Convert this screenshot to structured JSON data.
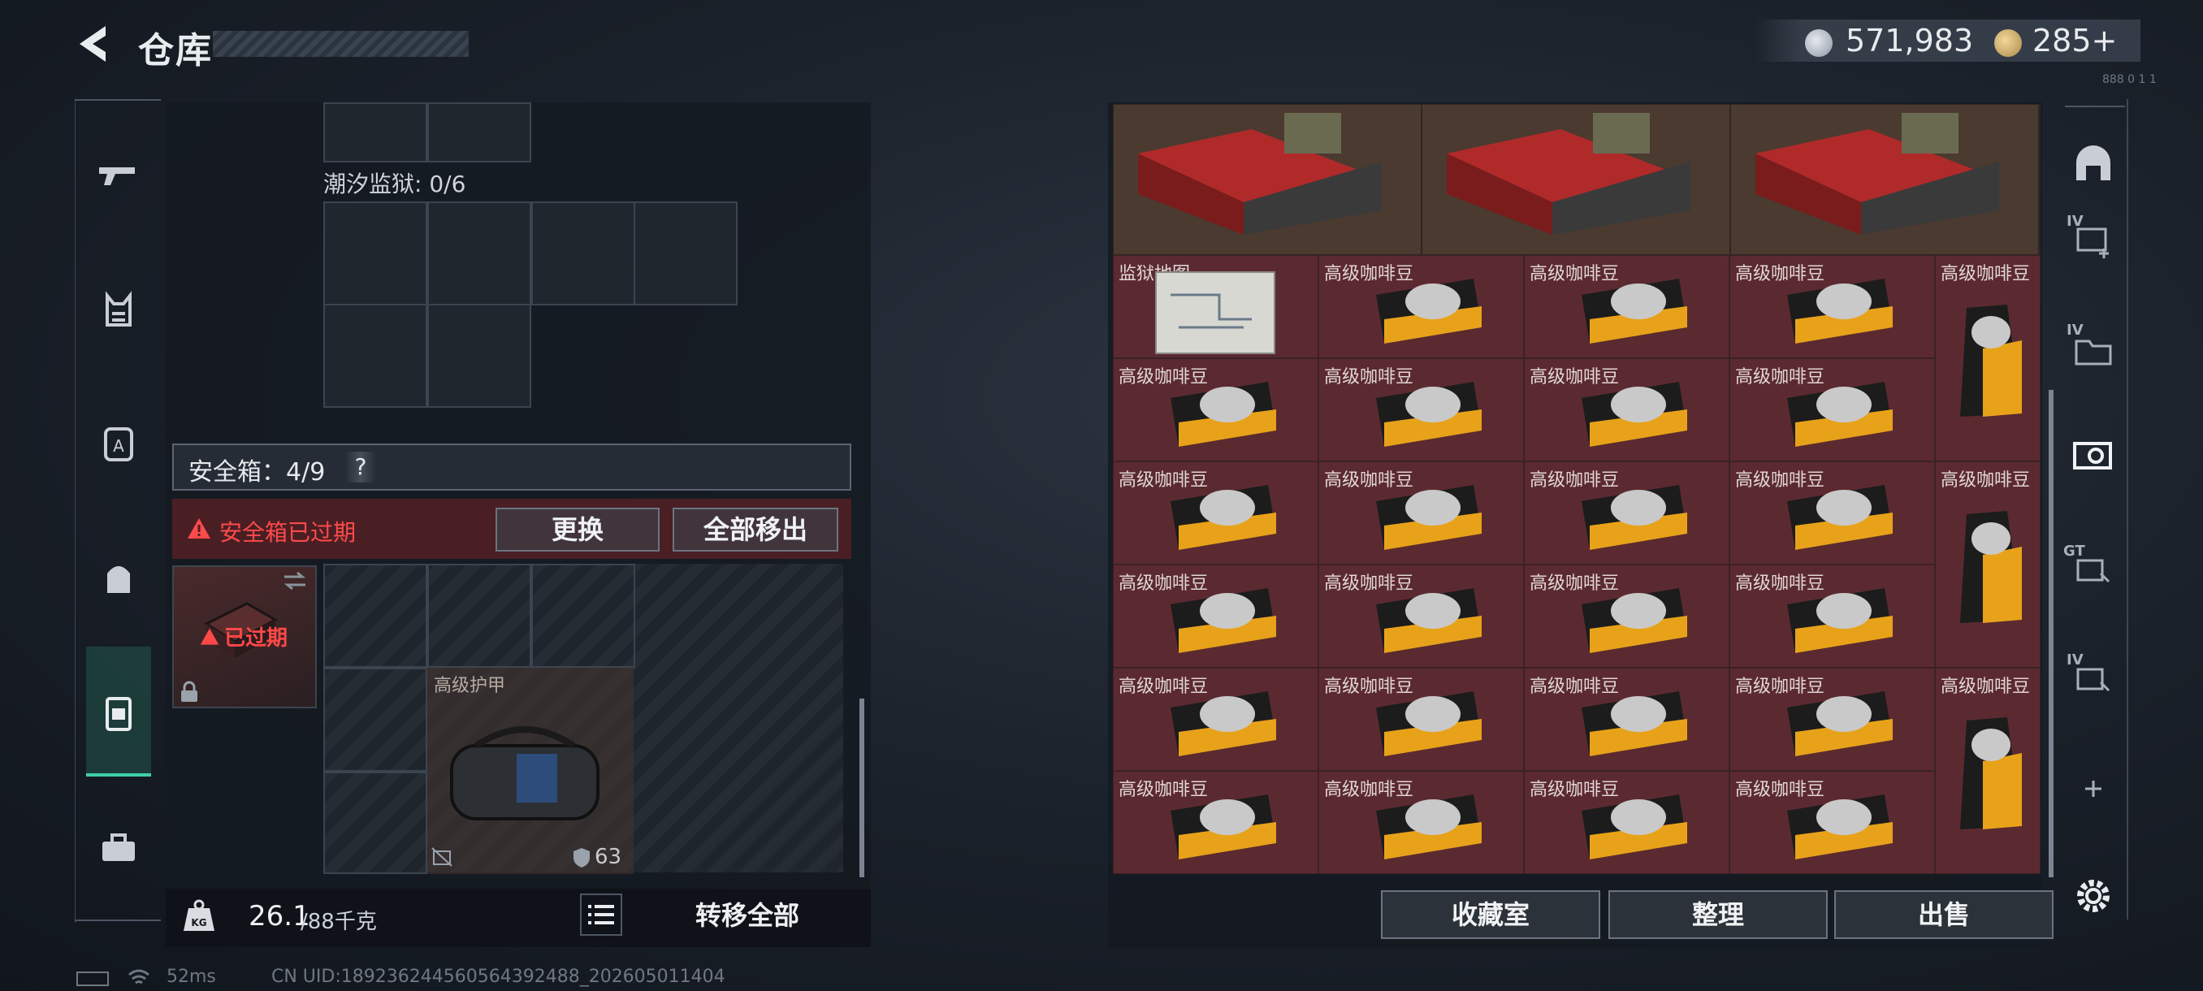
{
  "header": {
    "title": "仓库",
    "currency_primary": "571,983",
    "currency_secondary": "285+",
    "corner_label": "888 0 1 1"
  },
  "left_panel": {
    "prison_label": "潮汐监狱: 0/6",
    "safebox_label": "安全箱：4/9",
    "safebox_help": "?",
    "expired_warning": "安全箱已过期",
    "replace_button": "更换",
    "move_all_button": "全部移出",
    "safebox_item_status": "已过期",
    "armor_label": "高级护甲",
    "armor_durability": "63",
    "weight_current": "26.1",
    "weight_max": "/88千克",
    "weight_icon_label": "KG",
    "transfer_all_button": "转移全部"
  },
  "stash": {
    "map_item_label": "监狱地图",
    "coffee_label": "高级咖啡豆"
  },
  "stash_buttons": {
    "collection": "收藏室",
    "sort": "整理",
    "sell": "出售"
  },
  "right_nav": {
    "labels": [
      "IV",
      "IV",
      "GT",
      "IV"
    ]
  },
  "status_bar": {
    "ping": "52ms",
    "uid": "CN UID:18923624456056439248​8_202605011404"
  },
  "colors": {
    "accent": "#3fd0a8",
    "warning": "#ff4a4a",
    "stash_cell": "#5b2a30"
  }
}
